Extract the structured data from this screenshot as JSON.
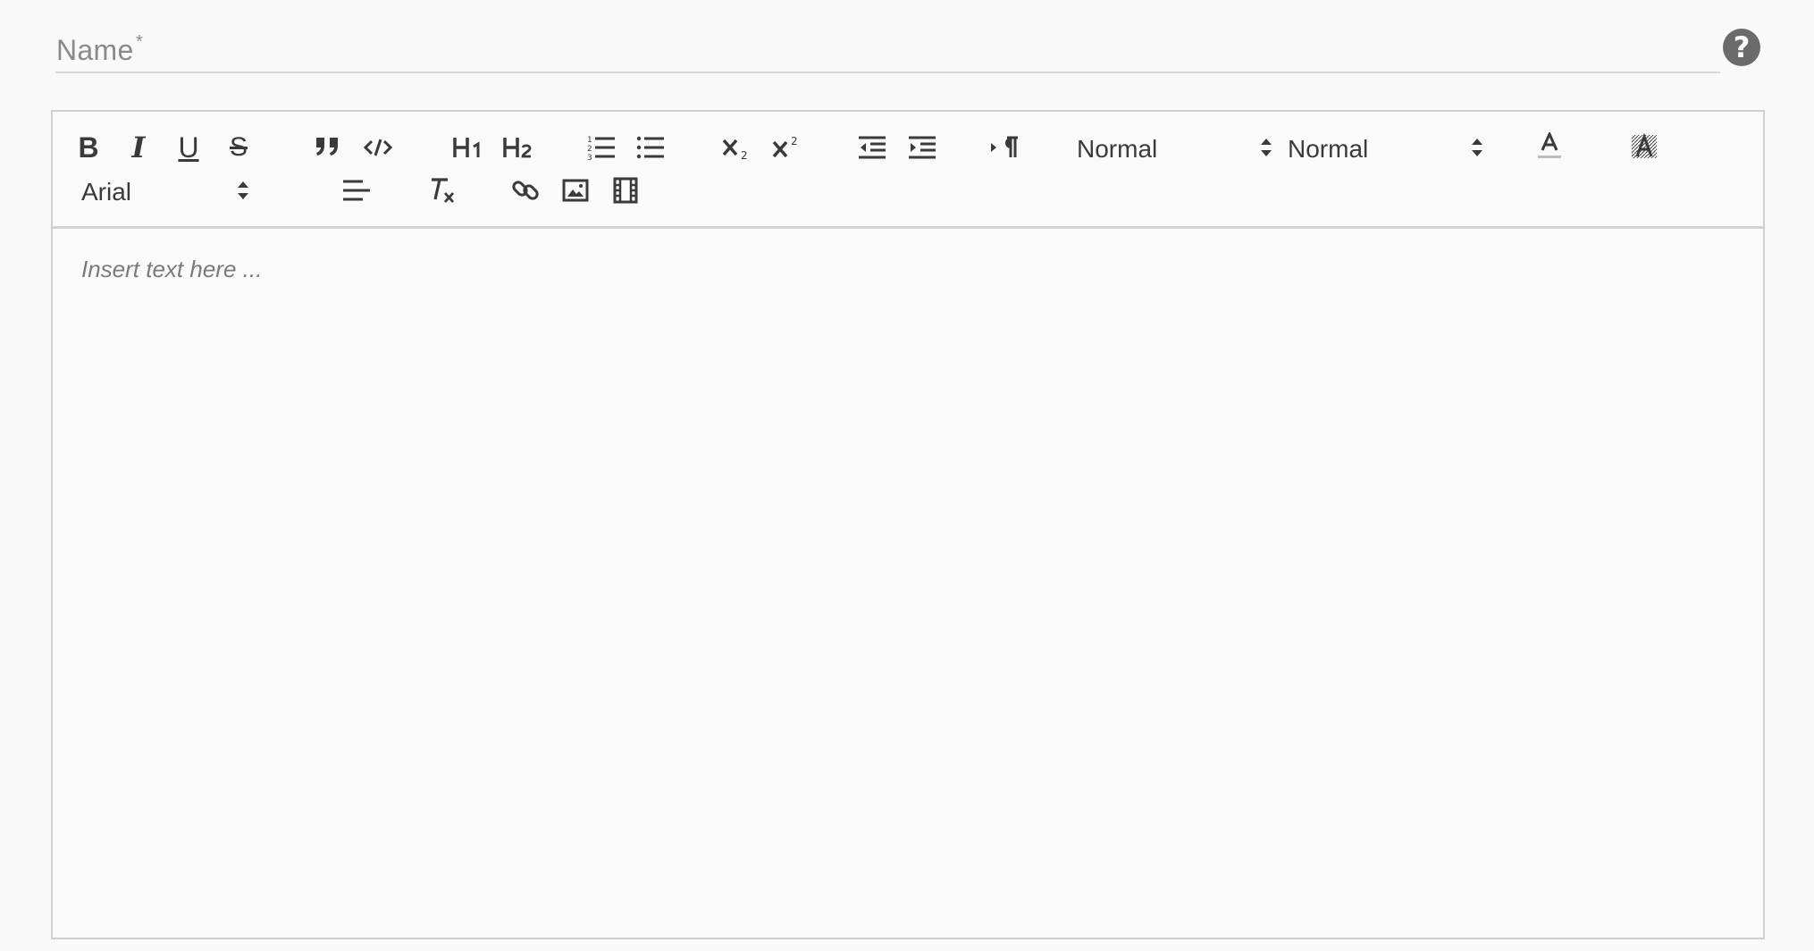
{
  "name_field": {
    "label": "Name",
    "required_marker": "*",
    "value": ""
  },
  "help": {
    "glyph": "?"
  },
  "toolbar": {
    "buttons": [
      {
        "name": "bold-icon",
        "glyph": "B"
      },
      {
        "name": "italic-icon",
        "glyph": "I"
      },
      {
        "name": "underline-icon",
        "glyph": "U"
      },
      {
        "name": "strikethrough-icon",
        "glyph": "S"
      },
      {
        "name": "blockquote-icon",
        "glyph": "”"
      },
      {
        "name": "code-block-icon",
        "glyph": "</>"
      },
      {
        "name": "heading-1-icon",
        "glyph": "H1"
      },
      {
        "name": "heading-2-icon",
        "glyph": "H2"
      },
      {
        "name": "ordered-list-icon",
        "glyph": "1."
      },
      {
        "name": "bullet-list-icon",
        "glyph": "•"
      },
      {
        "name": "subscript-icon",
        "glyph": "x₂"
      },
      {
        "name": "superscript-icon",
        "glyph": "x²"
      },
      {
        "name": "outdent-icon",
        "glyph": "⇤"
      },
      {
        "name": "indent-icon",
        "glyph": "⇥"
      },
      {
        "name": "text-direction-icon",
        "glyph": "¶"
      },
      {
        "name": "text-color-icon",
        "glyph": "A"
      },
      {
        "name": "background-color-icon",
        "glyph": "A"
      },
      {
        "name": "align-icon",
        "glyph": "≡"
      },
      {
        "name": "clear-formatting-icon",
        "glyph": "Tx"
      },
      {
        "name": "link-icon",
        "glyph": "∞"
      },
      {
        "name": "image-icon",
        "glyph": "▣"
      },
      {
        "name": "video-icon",
        "glyph": "▤"
      }
    ],
    "header_picker": "Normal",
    "size_picker": "Normal",
    "font_picker": "Arial"
  },
  "editor": {
    "placeholder": "Insert text here ...",
    "value": ""
  },
  "colors": {
    "icon": "#3a3a3a",
    "border": "#cfcfcf",
    "background": "#f9f9f9"
  }
}
